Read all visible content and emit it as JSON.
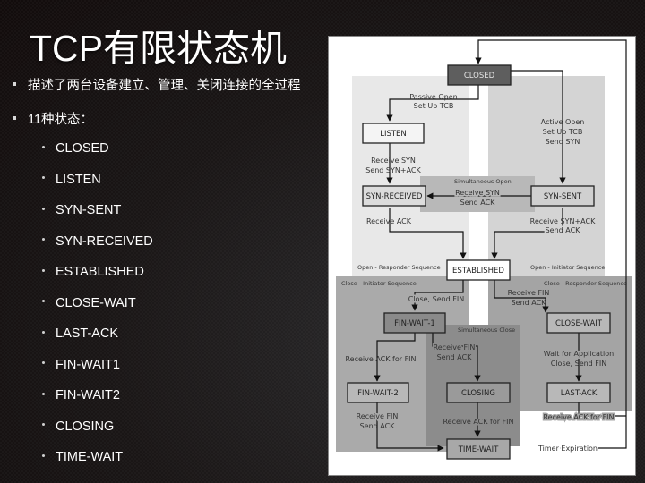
{
  "slide": {
    "title": "TCP有限状态机",
    "bullets": [
      "描述了两台设备建立、管理、关闭连接的全过程",
      "11种状态："
    ],
    "states_list": [
      "CLOSED",
      "LISTEN",
      "SYN-SENT",
      "SYN-RECEIVED",
      "ESTABLISHED",
      "CLOSE-WAIT",
      "LAST-ACK",
      "FIN-WAIT1",
      "FIN-WAIT2",
      "CLOSING",
      "TIME-WAIT"
    ]
  },
  "diagram": {
    "regions": {
      "open_responder": "Open - Responder Sequence",
      "open_initiator": "Open - Initiator Sequence",
      "simultaneous_open": "Simultaneous Open",
      "close_initiator": "Close - Initiator Sequence",
      "close_responder": "Close - Responder Sequence",
      "simultaneous_close": "Simultaneous Close"
    },
    "states": {
      "closed": "CLOSED",
      "listen": "LISTEN",
      "syn_received": "SYN-RECEIVED",
      "syn_sent": "SYN-SENT",
      "established": "ESTABLISHED",
      "fin_wait_1": "FIN-WAIT-1",
      "close_wait": "CLOSE-WAIT",
      "fin_wait_2": "FIN-WAIT-2",
      "closing": "CLOSING",
      "last_ack": "LAST-ACK",
      "time_wait": "TIME-WAIT"
    },
    "transitions": {
      "passive_open": [
        "Passive Open",
        "Set Up TCB"
      ],
      "active_open": [
        "Active Open",
        "Set Up TCB",
        "Send SYN"
      ],
      "listen_to_synrcvd": [
        "Receive SYN",
        "Send SYN+ACK"
      ],
      "simul_open": [
        "Receive SYN",
        "Send ACK"
      ],
      "synrcvd_to_est": [
        "Receive ACK"
      ],
      "synsent_to_est": [
        "Receive SYN+ACK",
        "Send ACK"
      ],
      "est_to_finwait1": [
        "Close, Send FIN"
      ],
      "est_to_closewait": [
        "Receive FIN",
        "Send ACK"
      ],
      "finwait1_to_finwait2": [
        "Receive ACK for FIN"
      ],
      "finwait1_to_closing": [
        "Receive FIN",
        "Send ACK"
      ],
      "closewait_to_lastack": [
        "Wait for Application",
        "Close, Send FIN"
      ],
      "finwait2_to_timewait": [
        "Receive FIN",
        "Send ACK"
      ],
      "closing_to_timewait": [
        "Receive ACK for FIN"
      ],
      "lastack_to_closed": [
        "Receive ACK for FIN"
      ],
      "timer": "Timer Expiration"
    }
  }
}
